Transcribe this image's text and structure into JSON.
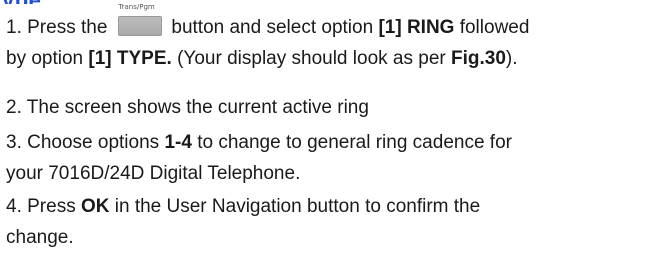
{
  "heading_fragment": "ype",
  "steps": [
    {
      "lines": [
        {
          "before_key": "1. Press the",
          "key_caption": "Trans/Pgm",
          "after_key": "button and select option ",
          "b1": "[1] RING",
          "t1": " followed"
        },
        {
          "t0": "by option ",
          "b1": "[1] TYPE.",
          "t1": " (Your display should look as per ",
          "b2": "Fig.30",
          "t2": ")."
        }
      ]
    },
    {
      "text": "2. The screen shows the current active ring"
    },
    {
      "lines": [
        {
          "t0": "3. Choose options ",
          "b1": "1-4",
          "t1": " to change to general ring cadence for"
        },
        {
          "t0": "your 7016D/24D Digital Telephone."
        }
      ]
    },
    {
      "lines": [
        {
          "t0": "4. Press ",
          "b1": "OK",
          "t1": " in the User Navigation button to confirm the"
        },
        {
          "t0": "change."
        }
      ]
    }
  ]
}
